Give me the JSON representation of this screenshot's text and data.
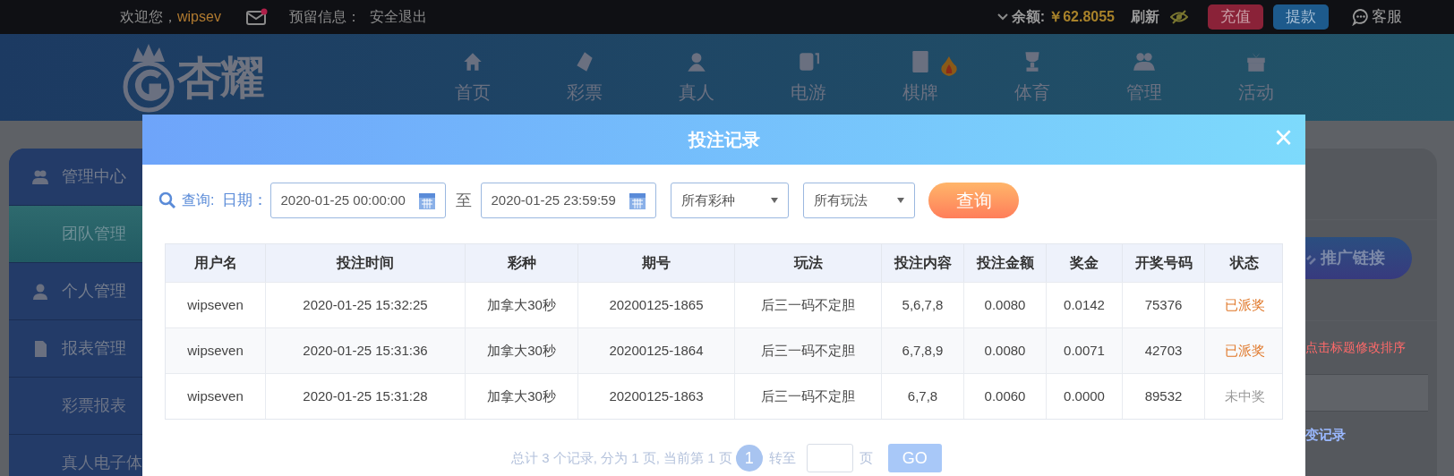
{
  "top_bar": {
    "greeting": "欢迎您，",
    "username": "wipsev",
    "unread_mail": true,
    "reserved_info": "预留信息：",
    "logout": "安全退出",
    "balance_label": "余额:",
    "balance": "￥62.8055",
    "refresh": "刷新",
    "recharge": "充值",
    "withdraw": "提款",
    "service": "客服"
  },
  "nav": {
    "logo_text": "杏耀",
    "items": [
      {
        "label": "首页",
        "hot": false
      },
      {
        "label": "彩票",
        "hot": false
      },
      {
        "label": "真人",
        "hot": false
      },
      {
        "label": "电游",
        "hot": false
      },
      {
        "label": "棋牌",
        "hot": true
      },
      {
        "label": "体育",
        "hot": false
      },
      {
        "label": "管理",
        "hot": false
      },
      {
        "label": "活动",
        "hot": false
      }
    ]
  },
  "sidebar": {
    "items": [
      {
        "kind": "section",
        "label": "管理中心",
        "selected": false
      },
      {
        "kind": "sub",
        "label": "团队管理",
        "selected": true
      },
      {
        "kind": "section",
        "label": "个人管理",
        "selected": false
      },
      {
        "kind": "section",
        "label": "报表管理",
        "selected": false
      },
      {
        "kind": "sub",
        "label": "彩票报表",
        "selected": false
      },
      {
        "kind": "sub",
        "label": "真人电子体",
        "selected": false
      }
    ]
  },
  "right_panel": {
    "promo_button": "推广链接",
    "hint": "点击标题修改排序",
    "link": "变记录"
  },
  "modal": {
    "title": "投注记录",
    "close": "×",
    "filter": {
      "search_label": "查询:",
      "date_label": "日期：",
      "start": "2020-01-25 00:00:00",
      "separator": "至",
      "end": "2020-01-25 23:59:59",
      "lottery_select": "所有彩种",
      "play_select": "所有玩法",
      "query_button": "查询"
    },
    "table": {
      "columns": [
        "用户名",
        "投注时间",
        "彩种",
        "期号",
        "玩法",
        "投注内容",
        "投注金额",
        "奖金",
        "开奖号码",
        "状态"
      ],
      "rows": [
        {
          "cells": [
            "wipseven",
            "2020-01-25 15:32:25",
            "加拿大30秒",
            "20200125-1865",
            "后三一码不定胆",
            "5,6,7,8",
            "0.0080",
            "0.0142",
            "75376",
            "已派奖"
          ],
          "paid": true
        },
        {
          "cells": [
            "wipseven",
            "2020-01-25 15:31:36",
            "加拿大30秒",
            "20200125-1864",
            "后三一码不定胆",
            "6,7,8,9",
            "0.0080",
            "0.0071",
            "42703",
            "已派奖"
          ],
          "paid": true
        },
        {
          "cells": [
            "wipseven",
            "2020-01-25 15:31:28",
            "加拿大30秒",
            "20200125-1863",
            "后三一码不定胆",
            "6,7,8",
            "0.0060",
            "0.0000",
            "89532",
            "未中奖"
          ],
          "paid": false
        }
      ]
    },
    "pagination": {
      "summary": "总计 3 个记录, 分为 1 页, 当前第 1 页",
      "pages": [
        {
          "label": "1",
          "selected": true
        }
      ],
      "goto_label": "转至",
      "page_unit": "页",
      "go_button": "GO"
    }
  }
}
